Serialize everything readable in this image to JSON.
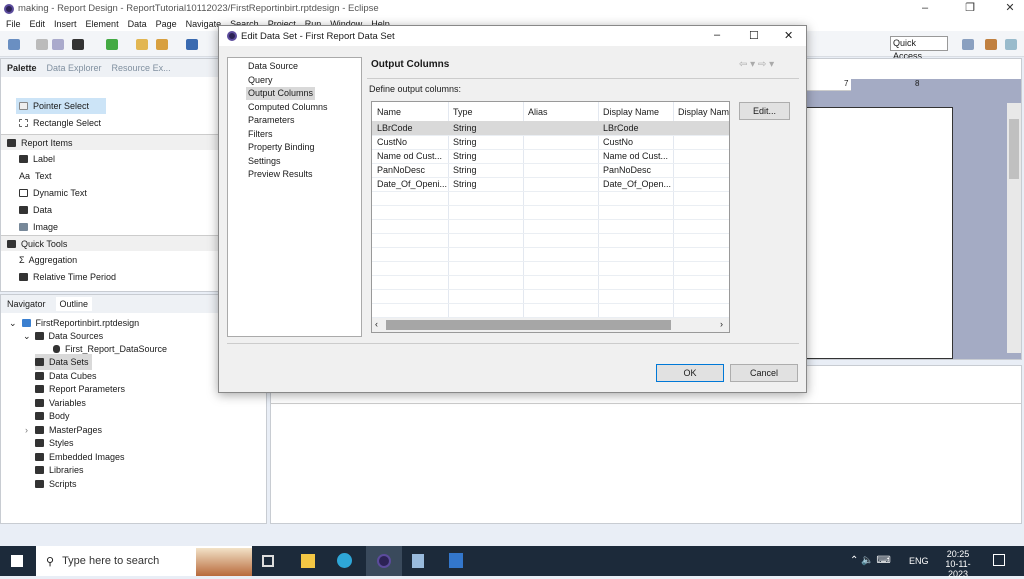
{
  "window": {
    "title": "making - Report Design - ReportTutorial10112023/FirstReportinbirt.rptdesign - Eclipse"
  },
  "menu": [
    "File",
    "Edit",
    "Insert",
    "Element",
    "Data",
    "Page",
    "Navigate",
    "Search",
    "Project",
    "Run",
    "Window",
    "Help"
  ],
  "quick_access": "Quick Access",
  "palette": {
    "tabs": [
      "Palette",
      "Data Explorer",
      "Resource Ex..."
    ],
    "tools": [
      "Pointer Select",
      "Rectangle Select"
    ],
    "report_items_title": "Report Items",
    "report_items": [
      "Label",
      "Text",
      "Dynamic Text",
      "Data",
      "Image"
    ],
    "quick_tools_title": "Quick Tools",
    "quick_tools": [
      "Aggregation",
      "Relative Time Period"
    ]
  },
  "outline": {
    "tabs": [
      "Navigator",
      "Outline"
    ],
    "root": "FirstReportinbirt.rptdesign",
    "data_sources": "Data Sources",
    "data_source_child": "First_Report_DataSource",
    "items": [
      "Data Sets",
      "Data Cubes",
      "Report Parameters",
      "Variables",
      "Body",
      "MasterPages",
      "Styles",
      "Embedded Images",
      "Libraries",
      "Scripts"
    ],
    "selected": "Data Sets"
  },
  "ruler": {
    "labels": [
      "7",
      "8"
    ]
  },
  "dialog": {
    "title": "Edit Data Set - First Report Data Set",
    "nav": [
      "Data Source",
      "Query",
      "Output Columns",
      "Computed Columns",
      "Parameters",
      "Filters",
      "Property Binding",
      "Settings",
      "Preview Results"
    ],
    "selected_nav": "Output Columns",
    "heading": "Output Columns",
    "subtitle": "Define output columns:",
    "columns": [
      "Name",
      "Type",
      "Alias",
      "Display Name",
      "Display Name"
    ],
    "rows": [
      [
        "LBrCode",
        "String",
        "",
        "LBrCode",
        ""
      ],
      [
        "CustNo",
        "String",
        "",
        "CustNo",
        ""
      ],
      [
        "Name od Cust...",
        "String",
        "",
        "Name od Cust...",
        ""
      ],
      [
        "PanNoDesc",
        "String",
        "",
        "PanNoDesc",
        ""
      ],
      [
        "Date_Of_Openi...",
        "String",
        "",
        "Date_Of_Open...",
        ""
      ]
    ],
    "edit_label": "Edit...",
    "ok_label": "OK",
    "cancel_label": "Cancel"
  },
  "taskbar": {
    "search_placeholder": "Type here to search",
    "lang": "ENG",
    "time": "20:25",
    "date": "10-11-2023"
  },
  "colors": {
    "selection": "#cce4f7",
    "accent": "#0078d7",
    "taskbar": "#1c2a3a"
  }
}
